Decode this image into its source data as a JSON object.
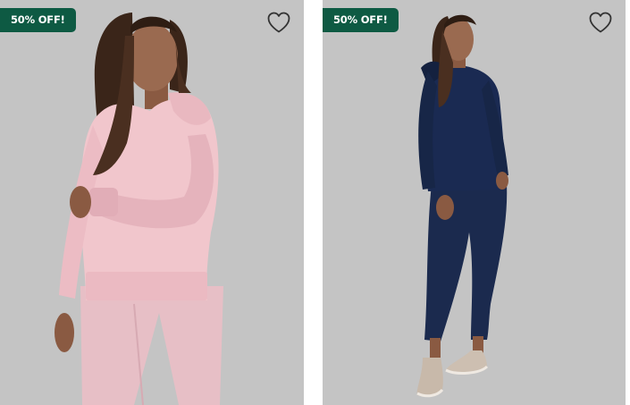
{
  "colors": {
    "background": "#c4c4c4",
    "badge": "#0e5a43",
    "heart_outline": "#333333"
  },
  "products": [
    {
      "badge": "50% OFF!",
      "image_alt": "Model wearing pink hoodie and matching joggers",
      "icon": "heart-outline-icon"
    },
    {
      "badge": "50% OFF!",
      "image_alt": "Model wearing navy hoodie and matching joggers with sneakers",
      "icon": "heart-outline-icon"
    }
  ]
}
